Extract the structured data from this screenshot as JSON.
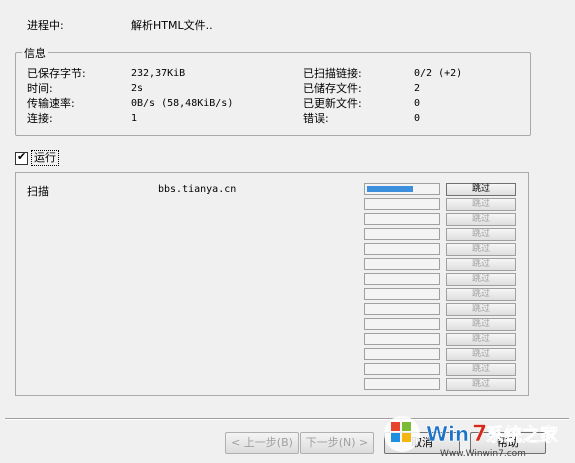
{
  "status": {
    "label": "进程中:",
    "value": "解析HTML文件.."
  },
  "info": {
    "title": "信息",
    "left": [
      {
        "label": "已保存字节:",
        "value": "232,37KiB"
      },
      {
        "label": "时间:",
        "value": "2s"
      },
      {
        "label": "传输速率:",
        "value": "0B/s (58,48KiB/s)"
      },
      {
        "label": "连接:",
        "value": "1"
      }
    ],
    "right": [
      {
        "label": "已扫描链接:",
        "value": "0/2 (+2)"
      },
      {
        "label": "已储存文件:",
        "value": "2"
      },
      {
        "label": "已更新文件:",
        "value": "0"
      },
      {
        "label": "错误:",
        "value": "0"
      }
    ]
  },
  "run_checkbox": {
    "label": "运行",
    "checked": true
  },
  "workers": [
    {
      "action": "扫描",
      "host": "bbs.tianya.cn",
      "progress": 0.65,
      "skip_label": "跳过",
      "active": true
    },
    {
      "skip_label": "跳过",
      "progress": 0
    },
    {
      "skip_label": "跳过",
      "progress": 0
    },
    {
      "skip_label": "跳过",
      "progress": 0
    },
    {
      "skip_label": "跳过",
      "progress": 0
    },
    {
      "skip_label": "跳过",
      "progress": 0
    },
    {
      "skip_label": "跳过",
      "progress": 0
    },
    {
      "skip_label": "跳过",
      "progress": 0
    },
    {
      "skip_label": "跳过",
      "progress": 0
    },
    {
      "skip_label": "跳过",
      "progress": 0
    },
    {
      "skip_label": "跳过",
      "progress": 0
    },
    {
      "skip_label": "跳过",
      "progress": 0
    },
    {
      "skip_label": "跳过",
      "progress": 0
    },
    {
      "skip_label": "跳过",
      "progress": 0
    }
  ],
  "buttons": {
    "back": "< 上一步(B)",
    "next": "下一步(N) >",
    "cancel": "取消",
    "help": "帮助"
  },
  "watermark": {
    "brand": "Win7系统之家",
    "url": "Www.Winwin7.com"
  },
  "colors": {
    "progress_fill": "#3b8fdd",
    "watermark_red": "#d42a1e",
    "watermark_blue": "#1e73c8"
  }
}
